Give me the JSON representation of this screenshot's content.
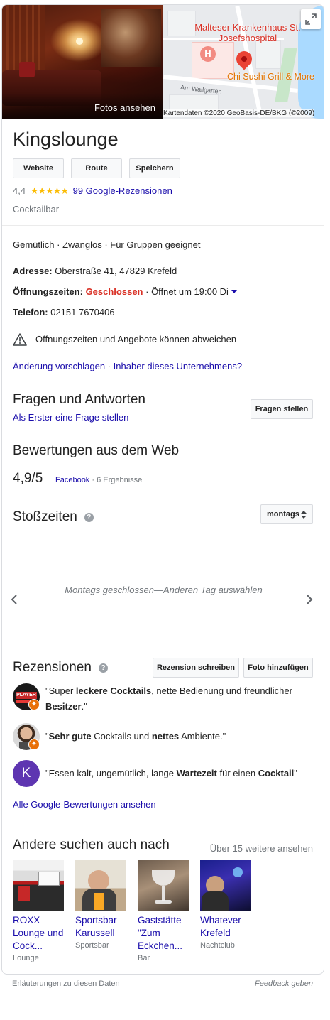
{
  "header": {
    "photo_label": "Fotos ansehen",
    "map": {
      "hospital_label": "Malteser Krankenhaus St. Josefshospital",
      "place_label": "Chi Sushi Grill & More",
      "street_label": "Am Wallgarten",
      "hospital_icon": "H",
      "attribution": "Kartendaten ©2020 GeoBasis-DE/BKG (©2009)"
    },
    "expand_icon": "expand-icon"
  },
  "business": {
    "name": "Kingslounge",
    "buttons": {
      "website": "Website",
      "route": "Route",
      "save": "Speichern"
    },
    "rating": "4,4",
    "stars": 4.4,
    "stars_glyph": "★★★★★",
    "reviews_link": "99 Google-Rezensionen",
    "category": "Cocktailbar"
  },
  "details": {
    "attributes": "Gemütlich · Zwanglos · Für Gruppen geeignet",
    "address_label": "Adresse:",
    "address_value": "Oberstraße 41, 47829 Krefeld",
    "hours_label": "Öffnungszeiten:",
    "hours_status": "Geschlossen",
    "hours_next": "· Öffnet um 19:00 Di",
    "phone_label": "Telefon:",
    "phone_value": "02151 7670406",
    "warning": "Öffnungszeiten und Angebote können abweichen",
    "suggest_edit": "Änderung vorschlagen",
    "separator": " · ",
    "owner_link": "Inhaber dieses Unternehmens?"
  },
  "qa": {
    "heading": "Fragen und Antworten",
    "first_question_link": "Als Erster eine Frage stellen",
    "ask_button": "Fragen stellen"
  },
  "web_reviews": {
    "heading": "Bewertungen aus dem Web",
    "score": "4,9/5",
    "source": "Facebook",
    "count": "· 6 Ergebnisse"
  },
  "popular_times": {
    "heading": "Stoßzeiten",
    "day_select": "montags",
    "empty_message": "Montags geschlossen—Anderen Tag auswählen"
  },
  "reviews": {
    "heading": "Rezensionen",
    "write_button": "Rezension schreiben",
    "photo_button": "Foto hinzufügen",
    "items": [
      {
        "p1": "\"Super ",
        "b1": "leckere Cocktails",
        "p2": ", nette Bedienung und freundlicher ",
        "b2": "Besitzer",
        "p3": ".\"",
        "avatar_text": "PLAYER"
      },
      {
        "p1": "\"",
        "b1": "Sehr gute",
        "p2": " Cocktails und ",
        "b2": "nettes",
        "p3": " Ambiente.\""
      },
      {
        "p1": "\"Essen kalt, ungemütlich, lange ",
        "b1": "Wartezeit",
        "p2": " für einen ",
        "b2": "Cocktail",
        "p3": "\"",
        "avatar_letter": "K"
      }
    ],
    "all_link": "Alle Google-Bewertungen ansehen"
  },
  "also_searched": {
    "heading": "Andere suchen auch nach",
    "more_link": "Über 15 weitere ansehen",
    "items": [
      {
        "name": "ROXX Lounge und Cock...",
        "category": "Lounge"
      },
      {
        "name": "Sportsbar Karussell",
        "category": "Sportsbar"
      },
      {
        "name": "Gaststätte \"Zum Eckchen...",
        "category": "Bar"
      },
      {
        "name": "Whatever Krefeld",
        "category": "Nachtclub"
      }
    ]
  },
  "footer": {
    "explanations": "Erläuterungen zu diesen Daten",
    "feedback": "Feedback geben"
  }
}
